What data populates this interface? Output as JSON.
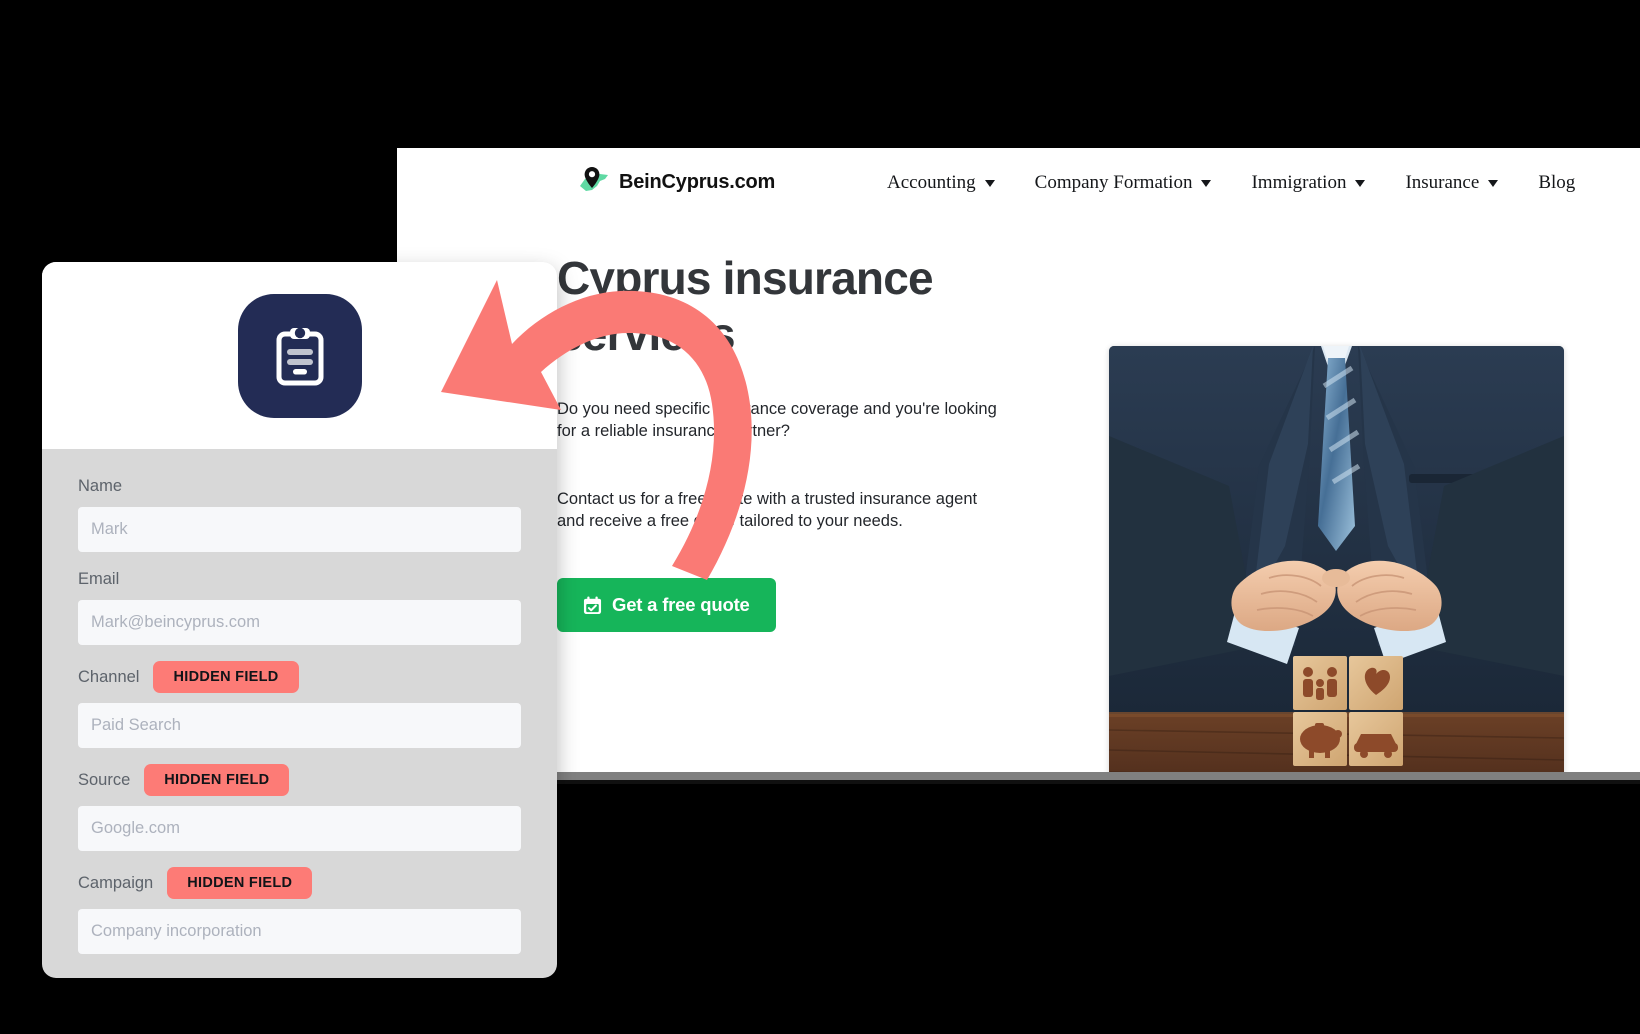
{
  "site": {
    "brand": {
      "name": "BeinCyprus.com",
      "logo_icon": "cyprus-map-pin-icon"
    },
    "nav": [
      {
        "label": "Accounting",
        "has_dropdown": true
      },
      {
        "label": "Company Formation",
        "has_dropdown": true
      },
      {
        "label": "Immigration",
        "has_dropdown": true
      },
      {
        "label": "Insurance",
        "has_dropdown": true
      },
      {
        "label": "Blog",
        "has_dropdown": false
      }
    ],
    "hero": {
      "title": "Cyprus insurance services",
      "paragraph_1": "Do you need specific insurance coverage and you're looking for a reliable insurance partner?",
      "paragraph_2": "Contact us for a free quote with a trusted insurance agent and receive a free quote tailored to your needs.",
      "cta_label": "Get a free quote",
      "cta_icon": "calendar-check-icon",
      "cta_color": "#16b55a",
      "image_alt": "Businessman in navy suit shielding four wooden blocks with family, heart, piggy bank and car icons"
    }
  },
  "form_card": {
    "header_icon": "clipboard-form-icon",
    "header_icon_bg": "#232c55",
    "hidden_badge_label": "HIDDEN FIELD",
    "hidden_badge_color": "#fd7b76",
    "fields": [
      {
        "label": "Name",
        "placeholder": "Mark",
        "hidden": false
      },
      {
        "label": "Email",
        "placeholder": "Mark@beincyprus.com",
        "hidden": false
      },
      {
        "label": "Channel",
        "placeholder": "Paid Search",
        "hidden": true
      },
      {
        "label": "Source",
        "placeholder": "Google.com",
        "hidden": true
      },
      {
        "label": "Campaign",
        "placeholder": "Company incorporation",
        "hidden": true
      }
    ]
  },
  "annotation": {
    "arrow_icon": "curved-left-arrow",
    "arrow_color": "#fa7a75"
  }
}
